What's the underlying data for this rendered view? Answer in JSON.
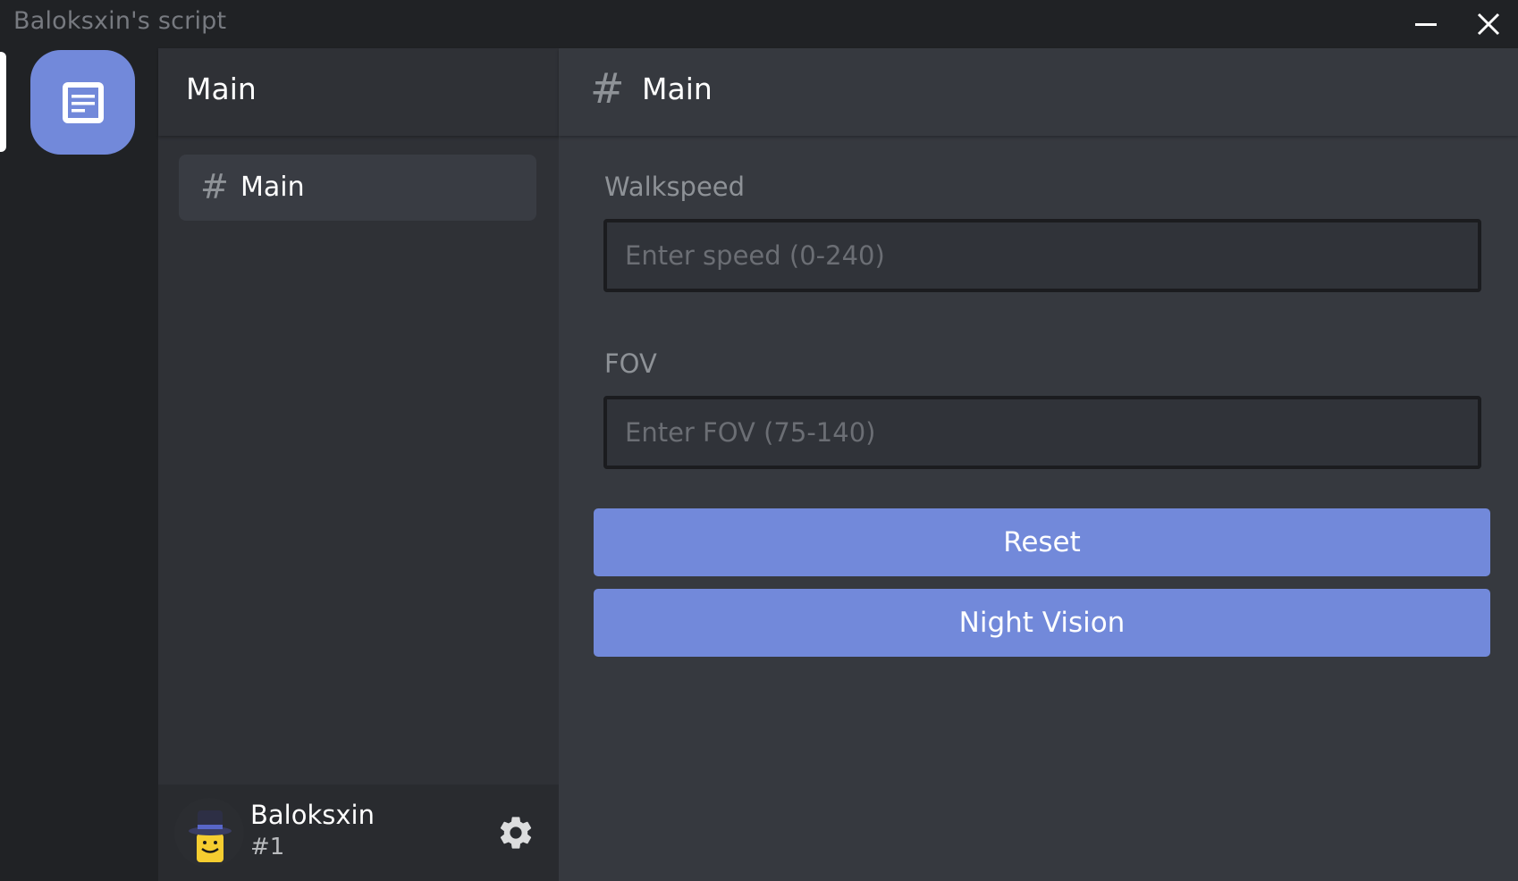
{
  "window": {
    "title": "Baloksxin's script"
  },
  "server": {
    "icon": "document-icon"
  },
  "channels": {
    "header_title": "Main",
    "items": [
      {
        "hash": "#",
        "label": "Main"
      }
    ]
  },
  "user": {
    "name": "Baloksxin",
    "tag": "#1",
    "settings_icon": "gear-icon"
  },
  "main": {
    "hash": "#",
    "title": "Main",
    "walkspeed": {
      "label": "Walkspeed",
      "placeholder": "Enter speed (0-240)",
      "value": ""
    },
    "fov": {
      "label": "FOV",
      "placeholder": "Enter FOV (75-140)",
      "value": ""
    },
    "buttons": {
      "reset": "Reset",
      "night_vision": "Night Vision"
    }
  },
  "colors": {
    "accent": "#7289da",
    "rail": "#202225",
    "sidebar": "#2f3136",
    "content": "#36393f"
  }
}
